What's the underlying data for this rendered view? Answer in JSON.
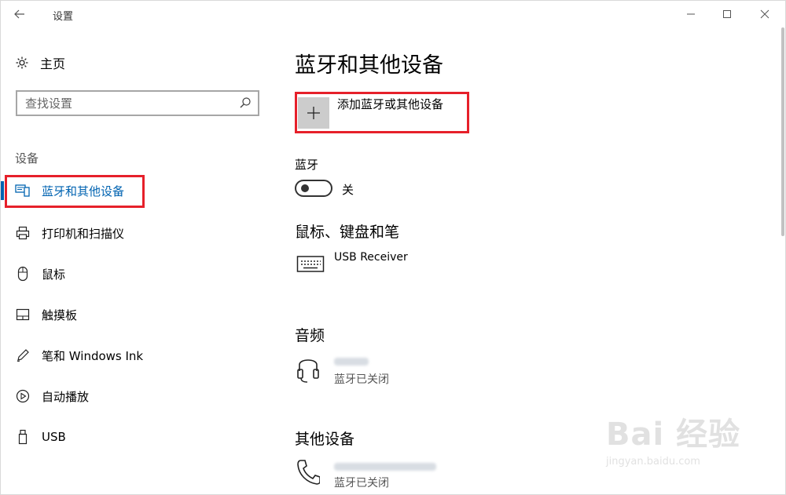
{
  "window": {
    "title": "设置"
  },
  "sidebar": {
    "home_label": "主页",
    "search_placeholder": "查找设置",
    "section_title": "设备",
    "items": [
      {
        "label": "蓝牙和其他设备",
        "icon": "bluetooth-devices-icon",
        "active": true
      },
      {
        "label": "打印机和扫描仪",
        "icon": "printer-icon",
        "active": false
      },
      {
        "label": "鼠标",
        "icon": "mouse-icon",
        "active": false
      },
      {
        "label": "触摸板",
        "icon": "touchpad-icon",
        "active": false
      },
      {
        "label": "笔和 Windows Ink",
        "icon": "pen-icon",
        "active": false
      },
      {
        "label": "自动播放",
        "icon": "autoplay-icon",
        "active": false
      },
      {
        "label": "USB",
        "icon": "usb-icon",
        "active": false
      }
    ]
  },
  "main": {
    "title": "蓝牙和其他设备",
    "add_device_label": "添加蓝牙或其他设备",
    "bluetooth": {
      "label": "蓝牙",
      "state_label": "关",
      "on": false
    },
    "mouse_section": {
      "title": "鼠标、键盘和笔",
      "devices": [
        {
          "name": "USB Receiver",
          "icon": "keyboard-icon"
        }
      ]
    },
    "audio_section": {
      "title": "音频",
      "devices": [
        {
          "status": "蓝牙已关闭",
          "icon": "headset-icon"
        }
      ]
    },
    "other_section": {
      "title": "其他设备",
      "devices": [
        {
          "status": "蓝牙已关闭",
          "icon": "phone-icon"
        }
      ]
    }
  },
  "watermark": {
    "text": "Bai 经验",
    "sub": "jingyan.baidu.com"
  },
  "colors": {
    "accent": "#0063b1",
    "highlight": "#e6202a",
    "add_button": "#cccccc"
  }
}
